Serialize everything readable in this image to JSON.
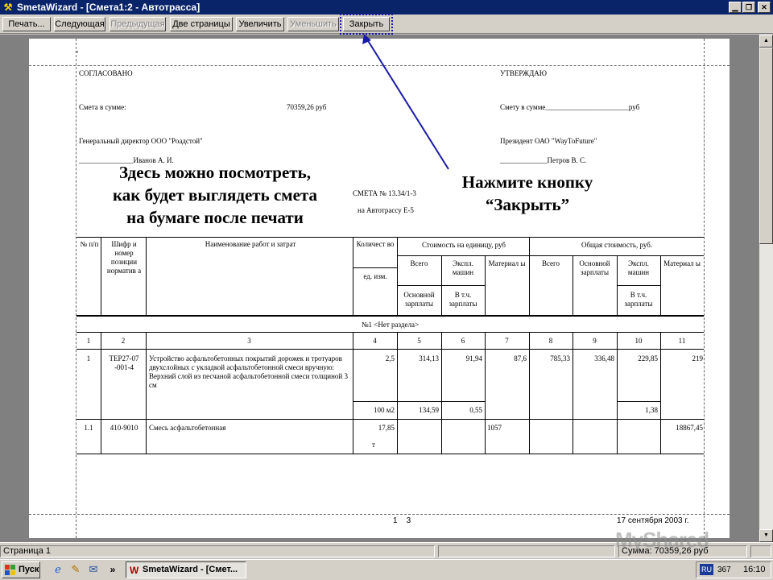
{
  "window": {
    "title": "SmetaWizard - [Смета1:2 - Автотрасса]"
  },
  "toolbar": {
    "print": "Печать...",
    "next": "Следующая",
    "prev": "Предыдущая",
    "two_pages": "Две страницы",
    "zoom_in": "Увеличить",
    "zoom_out": "Уменьшить",
    "close": "Закрыть"
  },
  "page": {
    "top_mark": "\"",
    "agreed": "СОГЛАСОВАНО",
    "approve": "УТВЕРЖДАЮ",
    "sum_label": "Смета в сумме:",
    "sum_value": "70359,26 руб",
    "sum_right": "Смету в сумме_______________________руб",
    "gd": "Генеральный директор ООО \"Роадстой\"",
    "president": "Президент ОАО \"WayToFuture\"",
    "sign_left": "_______________Иванов А. И.",
    "sign_right": "_____________Петров В. С.",
    "smeta_title": "СМЕТА № 13.34/1-3",
    "smeta_sub": "на Автотрассу Е-5",
    "footer_pages": "1    3",
    "footer_date": "17 сентября 2003 г."
  },
  "annotations": {
    "left": [
      "Здесь можно посмотреть,",
      "как будет выглядеть смета",
      "на бумаге после печати"
    ],
    "right": [
      "Нажмите кнопку",
      "“Закрыть”"
    ]
  },
  "table": {
    "h_num": "№ п/п",
    "h_code": "Шифр и номер позиции норматив а",
    "h_name": "Наименование работ и затрат",
    "h_qty": "Количест во",
    "h_unit": "ед. изм.",
    "h_unit_cost": "Стоимость на единицу, руб",
    "h_total_cost": "Общая стоимость, руб.",
    "h_all": "Всего",
    "h_expl": "Экспл. машин",
    "h_mat": "Материал ы",
    "h_base_sal": "Основной зарплаты",
    "h_incl": "В т.ч. зарплаты",
    "h_base_sal2": "Основной зарплаты",
    "h_expl2": "Экспл. машин",
    "h_mat2": "Материал ы",
    "h_incl2": "В т.ч. зарплаты",
    "section": "№1 <Нет раздела>",
    "colnums": [
      "1",
      "2",
      "3",
      "4",
      "5",
      "6",
      "7",
      "8",
      "9",
      "10",
      "11"
    ],
    "r1": {
      "num": "1",
      "code": "ТЕР27-07 -001-4",
      "name": "Устройство асфальтобетонных покрытий дорожек и тротуаров двухслойных с укладкой асфальтобетонной смеси вручную: Верхний слой из песчаной асфальтобетонной смеси толщиной 3 см",
      "qty": "2,5",
      "c5": "314,13",
      "c6": "91,94",
      "c7": "87,6",
      "c8": "785,33",
      "c9": "336,48",
      "c10": "229,85",
      "c11": "219",
      "unit": "100 м2",
      "c5b": "134,59",
      "c6b": "0,55",
      "c10b": "1,38"
    },
    "r2": {
      "num": "1.1",
      "code": "410-9010",
      "name": "Смесь асфальтобетонная",
      "qty": "17,85",
      "unit": "т",
      "c7": "1057",
      "c11": "18867,45"
    }
  },
  "statusbar": {
    "page": "Страница 1",
    "sum": "Сумма: 70359,26 руб"
  },
  "taskbar": {
    "start": "Пуск",
    "more": "»",
    "task": "SmetaWizard - [Смет...",
    "lang": "RU",
    "num": "367",
    "time": "16:10"
  },
  "watermark": "MyShared",
  "colors": {
    "title_bg": "#0a246a",
    "face": "#d4d0c8",
    "arrow": "#1a1aa8"
  }
}
